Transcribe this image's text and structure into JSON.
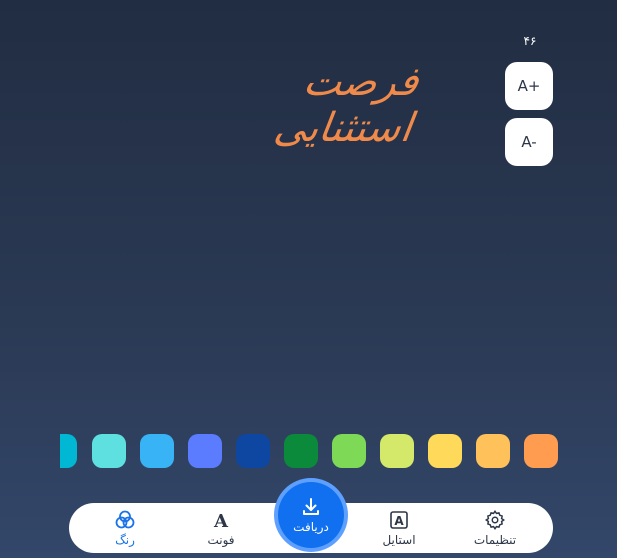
{
  "font_size": {
    "value": "۴۶",
    "increase_label": "A+",
    "decrease_label": "A-"
  },
  "preview": {
    "text": "فرصت استثنایی"
  },
  "palette": {
    "colors": [
      "#00b8d4",
      "#5ee0e0",
      "#38b3f5",
      "#5b7cff",
      "#0d47a1",
      "#0a8a3a",
      "#7ed957",
      "#d4e86a",
      "#ffd95a",
      "#ffc15a",
      "#ff9c50"
    ]
  },
  "bottom_nav": {
    "color_label": "رنگ",
    "font_label": "فونت",
    "download_label": "دریافت",
    "style_label": "استایل",
    "settings_label": "تنظیمات"
  }
}
